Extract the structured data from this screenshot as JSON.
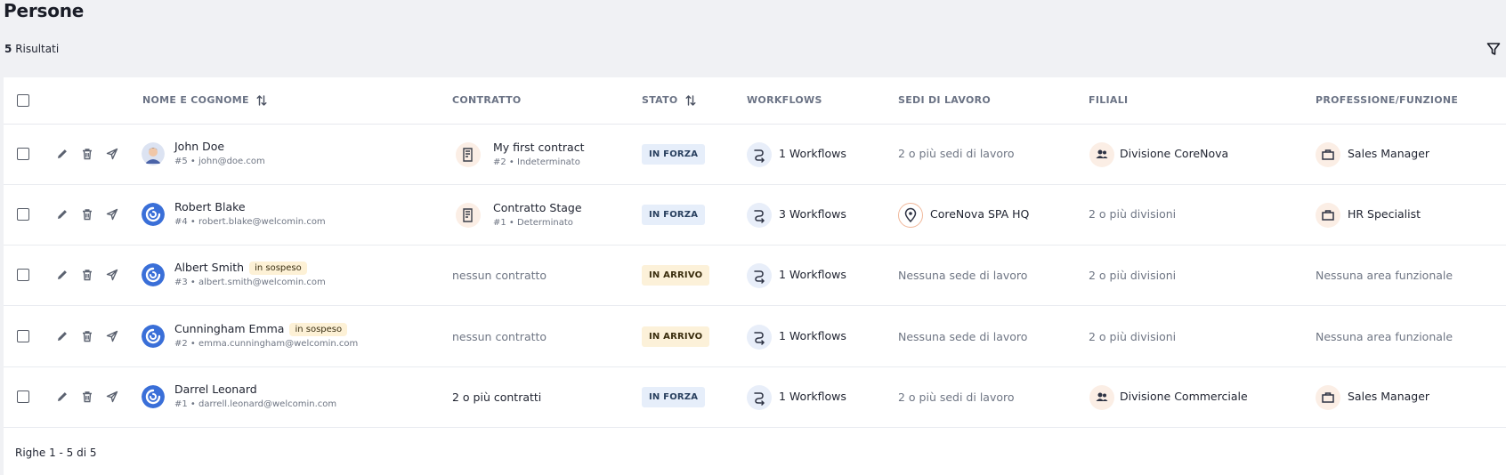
{
  "page": {
    "title": "Persone",
    "results_count": "5",
    "results_label": "Risultati"
  },
  "table": {
    "columns": {
      "name": "NOME E COGNOME",
      "contract": "CONTRATTO",
      "status": "STATO",
      "workflows": "WORKFLOWS",
      "locations": "SEDI DI LAVORO",
      "branches": "FILIALI",
      "profession": "PROFESSIONE/FUNZIONE"
    },
    "rows": [
      {
        "name": "John Doe",
        "suspended": "",
        "sub": "#5 • john@doe.com",
        "contract_title": "My first contract",
        "contract_sub": "#2 • Indeterminato",
        "status": "IN FORZA",
        "workflows": "1 Workflows",
        "location": "2 o più sedi di lavoro",
        "branch": "Divisione CoreNova",
        "profession": "Sales Manager"
      },
      {
        "name": "Robert Blake",
        "suspended": "",
        "sub": "#4 • robert.blake@welcomin.com",
        "contract_title": "Contratto Stage",
        "contract_sub": "#1 • Determinato",
        "status": "IN FORZA",
        "workflows": "3 Workflows",
        "location": "CoreNova SPA HQ",
        "branch": "2 o più divisioni",
        "profession": "HR Specialist"
      },
      {
        "name": "Albert Smith",
        "suspended": "in sospeso",
        "sub": "#3 • albert.smith@welcomin.com",
        "contract_title": "nessun contratto",
        "contract_sub": "",
        "status": "IN ARRIVO",
        "workflows": "1 Workflows",
        "location": "Nessuna sede di lavoro",
        "branch": "2 o più divisioni",
        "profession": "Nessuna area funzionale"
      },
      {
        "name": "Cunningham Emma",
        "suspended": "in sospeso",
        "sub": "#2 • emma.cunningham@welcomin.com",
        "contract_title": "nessun contratto",
        "contract_sub": "",
        "status": "IN ARRIVO",
        "workflows": "1 Workflows",
        "location": "Nessuna sede di lavoro",
        "branch": "2 o più divisioni",
        "profession": "Nessuna area funzionale"
      },
      {
        "name": "Darrel Leonard",
        "suspended": "",
        "sub": "#1 • darrell.leonard@welcomin.com",
        "contract_title": "2 o più contratti",
        "contract_sub": "",
        "status": "IN FORZA",
        "workflows": "1 Workflows",
        "location": "2 o più sedi di lavoro",
        "branch": "Divisione Commerciale",
        "profession": "Sales Manager"
      }
    ]
  },
  "footer": {
    "pagination": "Righe 1 - 5 di 5"
  },
  "icons": {
    "filter": "filter-icon",
    "sort": "sort-arrows-icon",
    "edit": "pencil-icon",
    "delete": "trash-icon",
    "send": "send-icon",
    "contract": "document-icon",
    "workflow": "workflow-icon",
    "location": "map-pin-icon",
    "branch": "people-icon",
    "profession": "briefcase-icon"
  },
  "colors": {
    "accent": "#3a6fd8",
    "status_forza_bg": "#e6eefa",
    "status_arrivo_bg": "#fcf1d9",
    "suspended_bg": "#fdf1d6"
  }
}
